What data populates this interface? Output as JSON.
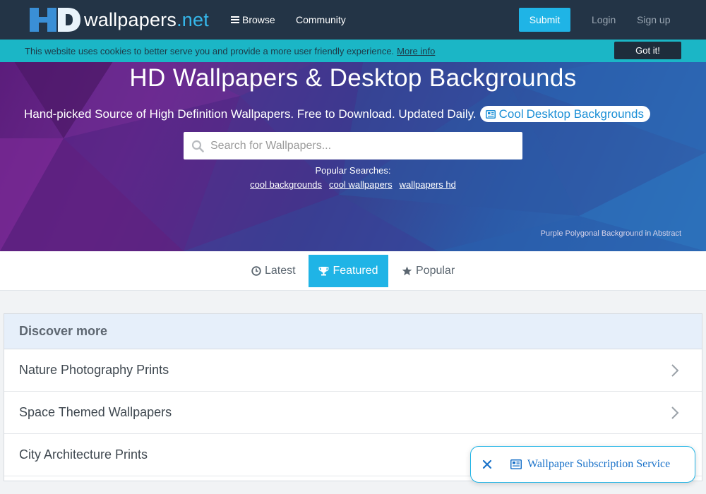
{
  "header": {
    "logo_text": "wallpapers",
    "logo_ext": ".net",
    "nav": {
      "browse": "Browse",
      "community": "Community"
    },
    "submit_label": "Submit",
    "login_label": "Login",
    "signup_label": "Sign up"
  },
  "cookie_bar": {
    "message": "This website uses cookies to better serve you and provide a more user friendly experience.",
    "more_info": "More info",
    "accept_label": "Got it!"
  },
  "hero": {
    "title": "HD Wallpapers & Desktop Backgrounds",
    "subtitle": "Hand-picked Source of High Definition Wallpapers. Free to Download. Updated Daily.",
    "pill_cool": "Cool",
    "pill_rest": "Desktop Backgrounds",
    "search_placeholder": "Search for Wallpapers...",
    "search_value": "",
    "popular_label": "Popular Searches:",
    "popular_searches": [
      "cool backgrounds",
      "cool wallpapers",
      "wallpapers hd"
    ],
    "credit": "Purple Polygonal Background in Abstract"
  },
  "tabs": {
    "latest": "Latest",
    "featured": "Featured",
    "popular": "Popular",
    "active": "featured"
  },
  "discover": {
    "title": "Discover more",
    "items": [
      "Nature Photography Prints",
      "Space Themed Wallpapers",
      "City Architecture Prints"
    ]
  },
  "floating_ad": {
    "label": "Wallpaper Subscription Service"
  },
  "colors": {
    "nav_bg": "#233446",
    "accent": "#1fb4e6",
    "cookie_bg": "#1bb6c6",
    "link_blue": "#1a72c9"
  },
  "icons": {
    "browse": "hamburger-icon",
    "pill": "newspaper-icon",
    "search": "search-icon",
    "latest": "clock-icon",
    "featured": "trophy-icon",
    "popular": "star-icon",
    "discover_row": "chevron-right-icon",
    "float_close": "close-icon",
    "float_ad": "newspaper-icon"
  }
}
